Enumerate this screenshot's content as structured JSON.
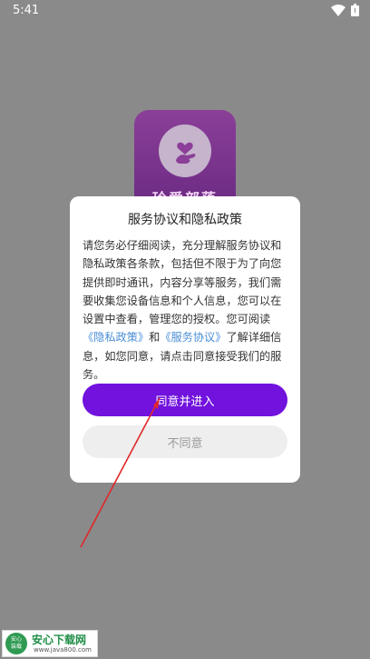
{
  "status_bar": {
    "time": "5:41",
    "wifi_icon": "wifi-icon",
    "battery_icon": "battery-icon"
  },
  "app": {
    "logo_text": "玲爱部落",
    "logo_icon": "finger-heart-icon"
  },
  "dialog": {
    "title": "服务协议和隐私政策",
    "body_part1": "请您务必仔细阅读，充分理解服务协议和隐私政策各条款，包括但不限于为了向您提供即时通讯，内容分享等服务，我们需要收集您设备信息和个人信息，您可以在设置中查看，管理您的授权。您可阅读",
    "privacy_link": "《隐私政策》",
    "and_text": "和",
    "service_link": "《服务协议》",
    "body_part2": "了解详细信息，如您同意，请点击同意接受我们的服务。",
    "agree_label": "同意并进入",
    "disagree_label": "不同意"
  },
  "watermark": {
    "icon_line1": "安心",
    "icon_line2": "装载",
    "name": "安心下载网",
    "url": "www.java800.com"
  },
  "colors": {
    "overlay": "#8a8a8a",
    "primary": "#7112dd",
    "link": "#4a8ed6",
    "annotation": "#e0282a"
  }
}
